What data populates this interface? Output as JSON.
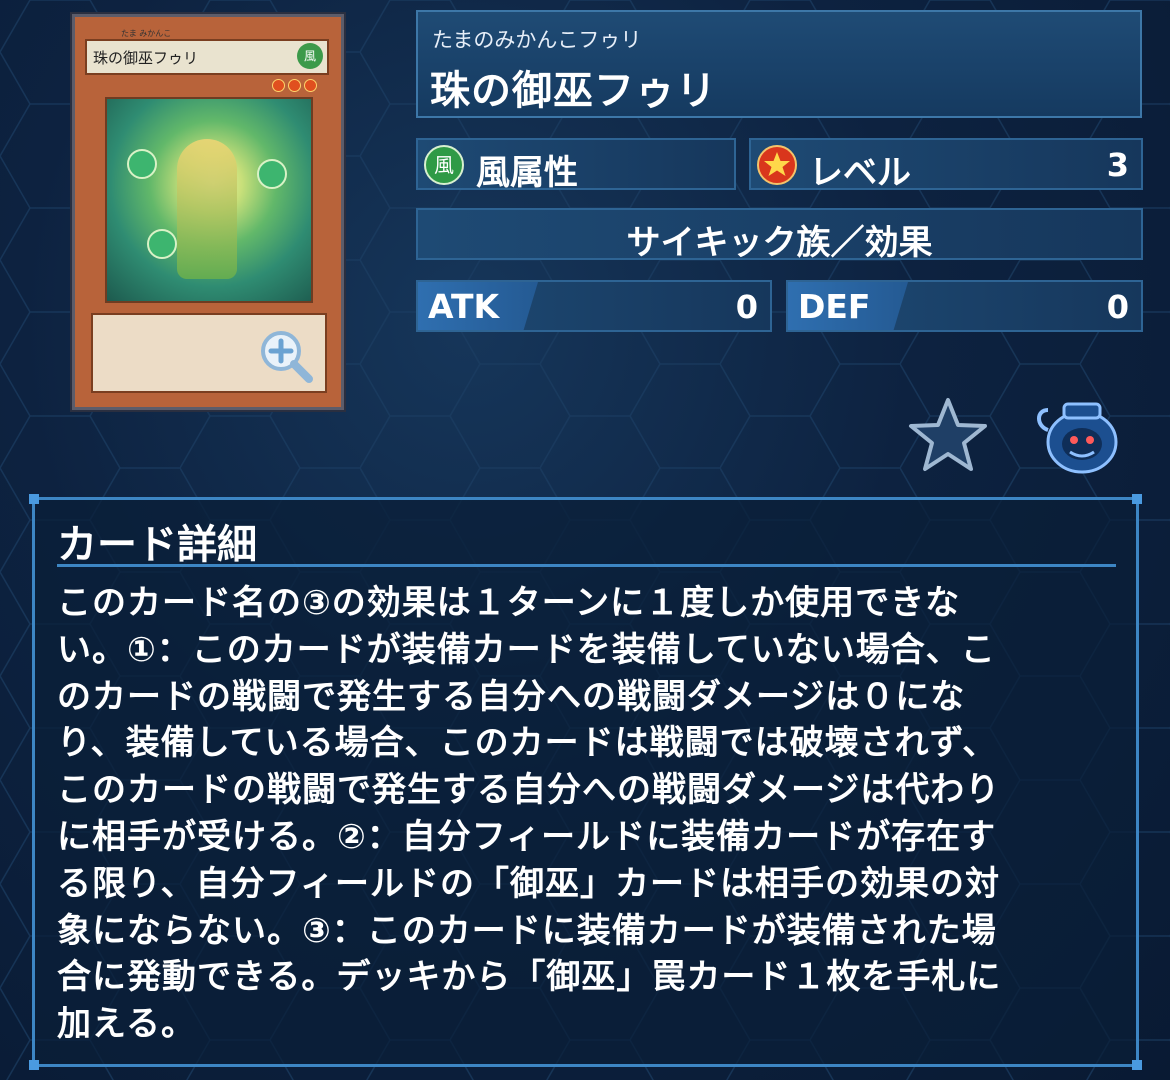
{
  "card": {
    "name_on_card": "珠の御巫フゥリ",
    "ruby_on_card": "たま みかんこ",
    "attribute_on_card": "風",
    "stars": 3
  },
  "header": {
    "ruby": "たまのみかんこフゥリ",
    "name": "珠の御巫フゥリ"
  },
  "stats": {
    "attribute": "風属性",
    "attribute_icon_char": "風",
    "level_label": "レベル",
    "level_value": "3",
    "type": "サイキック族／効果",
    "atk_label": "ATK",
    "atk_value": "0",
    "def_label": "DEF",
    "def_value": "0"
  },
  "icons": {
    "attribute": "wind-attribute-icon",
    "level": "level-star-icon",
    "zoom": "zoom-in-icon",
    "favorite": "favorite-star-icon",
    "pot": "pot-of-greed-icon"
  },
  "details": {
    "title": "カード詳細",
    "lines": [
      "このカード名の③の効果は１ターンに１度しか使用できな",
      "い。①：このカードが装備カードを装備していない場合、こ",
      "のカードの戦闘で発生する自分への戦闘ダメージは０にな",
      "り、装備している場合、このカードは戦闘では破壊されず、",
      "このカードの戦闘で発生する自分への戦闘ダメージは代わり",
      "に相手が受ける。②：自分フィールドに装備カードが存在す",
      "る限り、自分フィールドの「御巫」カードは相手の効果の対",
      "象にならない。③：このカードに装備カードが装備された場",
      "合に発動できる。デッキから「御巫」罠カード１枚を手札に",
      "加える。"
    ]
  },
  "colors": {
    "background": "#0d2240",
    "panel": "#1e4a74",
    "border": "#3d86c4",
    "stat_tag": "#2f6fb0",
    "card_frame": "#b8633a"
  }
}
